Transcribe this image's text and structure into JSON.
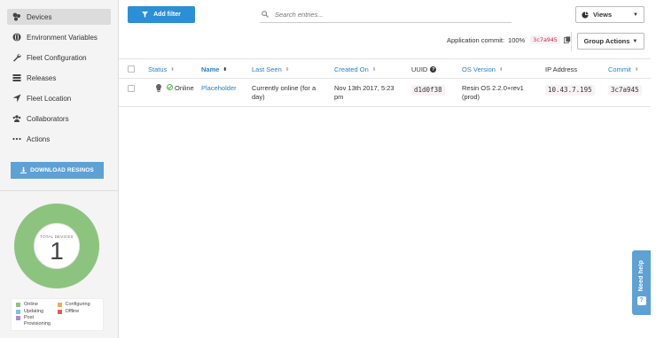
{
  "sidebar": {
    "items": [
      {
        "label": "Devices",
        "icon": "devices-icon",
        "active": true
      },
      {
        "label": "Environment Variables",
        "icon": "globe-icon",
        "active": false
      },
      {
        "label": "Fleet Configuration",
        "icon": "wrench-icon",
        "active": false
      },
      {
        "label": "Releases",
        "icon": "releases-icon",
        "active": false
      },
      {
        "label": "Fleet Location",
        "icon": "location-arrow-icon",
        "active": false
      },
      {
        "label": "Collaborators",
        "icon": "users-icon",
        "active": false
      },
      {
        "label": "Actions",
        "icon": "ellipsis-icon",
        "active": false
      }
    ],
    "download_label": "DOWNLOAD RESINOS",
    "summary": {
      "total_label": "TOTAL DEVICES",
      "total_count": "1",
      "online_fraction": 1.0
    },
    "legend": [
      {
        "label": "Online",
        "color": "#8cc47f"
      },
      {
        "label": "Configuring",
        "color": "#f0ad4e"
      },
      {
        "label": "Updating",
        "color": "#7fbfe8"
      },
      {
        "label": "Offline",
        "color": "#e9585b"
      },
      {
        "label": "Post Provisioning",
        "color": "#a98bd1"
      }
    ]
  },
  "toolbar": {
    "add_filter_label": "Add filter",
    "search_placeholder": "Search entries...",
    "views_label": "Views",
    "app_commit_label": "Application commit:",
    "app_commit_percent": "100%",
    "app_commit_hash": "3c7a945",
    "group_actions_label": "Group Actions"
  },
  "table": {
    "columns": [
      "Status",
      "Name",
      "Last Seen",
      "Created On",
      "UUID",
      "OS Version",
      "IP Address",
      "Commit"
    ],
    "rows": [
      {
        "status": "Online",
        "name": "Placeholder",
        "last_seen": "Currently online (for a day)",
        "created_on": "Nov 13th 2017, 5:23 pm",
        "uuid": "d1d0f38",
        "os_version": "Resin OS 2.2.0+rev1 (prod)",
        "ip_address": "10.43.7.195",
        "commit": "3c7a945"
      }
    ]
  },
  "help": {
    "label": "Need help",
    "glyph": "?"
  },
  "colors": {
    "accent": "#2a8fd6",
    "online": "#8cc47f",
    "hash_text": "#c7254e"
  }
}
